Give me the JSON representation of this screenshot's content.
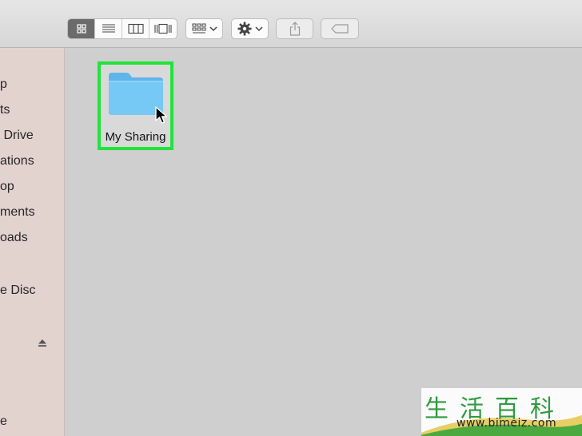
{
  "toolbar": {
    "view_buttons": [
      "icon-view",
      "list-view",
      "column-view",
      "gallery-view"
    ],
    "active_view": "icon-view",
    "icons": {
      "arrange": "grid-icon",
      "action": "gear-icon",
      "share": "share-icon",
      "tags": "tag-icon",
      "dropdown": "chevron-down-icon"
    }
  },
  "sidebar": {
    "items": [
      {
        "label": "p"
      },
      {
        "label": "ts"
      },
      {
        "label": " Drive"
      },
      {
        "label": "ations"
      },
      {
        "label": "op"
      },
      {
        "label": "ments"
      },
      {
        "label": "oads"
      },
      {
        "label": "e Disc"
      },
      {
        "label": "e"
      }
    ]
  },
  "content": {
    "folder": {
      "name": "My Sharing",
      "icon": "folder-icon",
      "selected": true,
      "highlight_color": "#22e33a"
    }
  },
  "watermark": {
    "chars": [
      "生",
      "活",
      "百",
      "科"
    ],
    "url": "www.bimeiz.com"
  },
  "colors": {
    "sidebar_bg": "#e3d3cf",
    "content_bg": "#cfcfcf",
    "folder_blue": "#6ec3f3",
    "highlight": "#22e33a"
  }
}
